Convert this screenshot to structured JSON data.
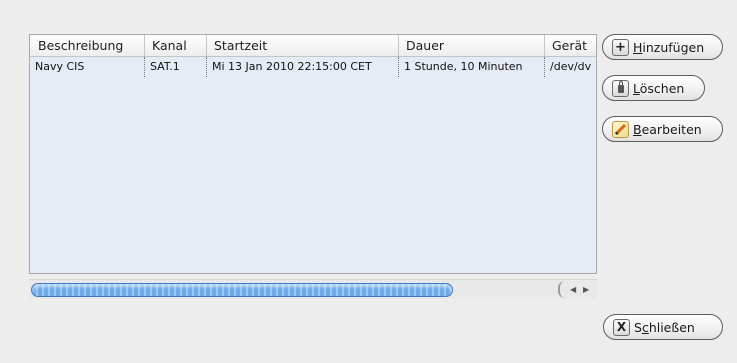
{
  "table": {
    "columns": [
      "Beschreibung",
      "Kanal",
      "Startzeit",
      "Dauer",
      "Gerät"
    ],
    "rows": [
      [
        "Navy CIS",
        "SAT.1",
        "Mi 13 Jan 2010 22:15:00 CET",
        "1 Stunde, 10 Minuten",
        "/dev/dv"
      ]
    ]
  },
  "buttons": {
    "add": {
      "pre": "",
      "key": "H",
      "post": "inzufügen"
    },
    "delete": {
      "pre": "",
      "key": "L",
      "post": "öschen"
    },
    "edit": {
      "pre": "",
      "key": "B",
      "post": "earbeiten"
    },
    "close": {
      "pre": "S",
      "key": "c",
      "post": "hließen"
    }
  },
  "icons": {
    "add": "plus-icon",
    "delete": "lock-icon",
    "edit": "pencil-note-icon",
    "close": "x-icon"
  },
  "scrollbar": {
    "position_fraction": 0.0,
    "visible_fraction": 0.75
  }
}
